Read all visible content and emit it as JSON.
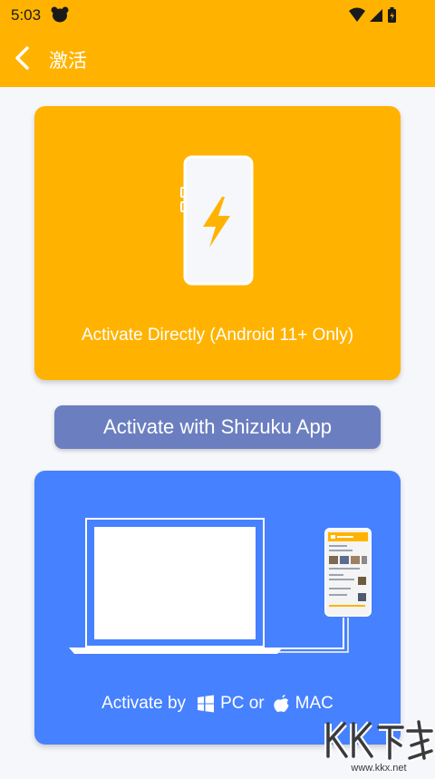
{
  "status_bar": {
    "time": "5:03"
  },
  "app_bar": {
    "title": "激活"
  },
  "direct_card": {
    "label": "Activate Directly (Android 11+ Only)"
  },
  "shizuku_button": {
    "label": "Activate with Shizuku App"
  },
  "pc_card": {
    "label_prefix": "Activate by",
    "pc_label": "PC or",
    "mac_label": "MAC"
  },
  "watermark": {
    "brand": "KK下载",
    "url": "www.kkx.net"
  },
  "colors": {
    "primary": "#ffb300",
    "shizuku": "#6b7fc0",
    "pc_card": "#4681ff",
    "background": "#f6f7fb"
  },
  "icons": [
    "bear-icon",
    "wifi-icon",
    "signal-icon",
    "battery-icon",
    "back-arrow-icon",
    "lightning-icon",
    "windows-icon",
    "apple-icon"
  ]
}
